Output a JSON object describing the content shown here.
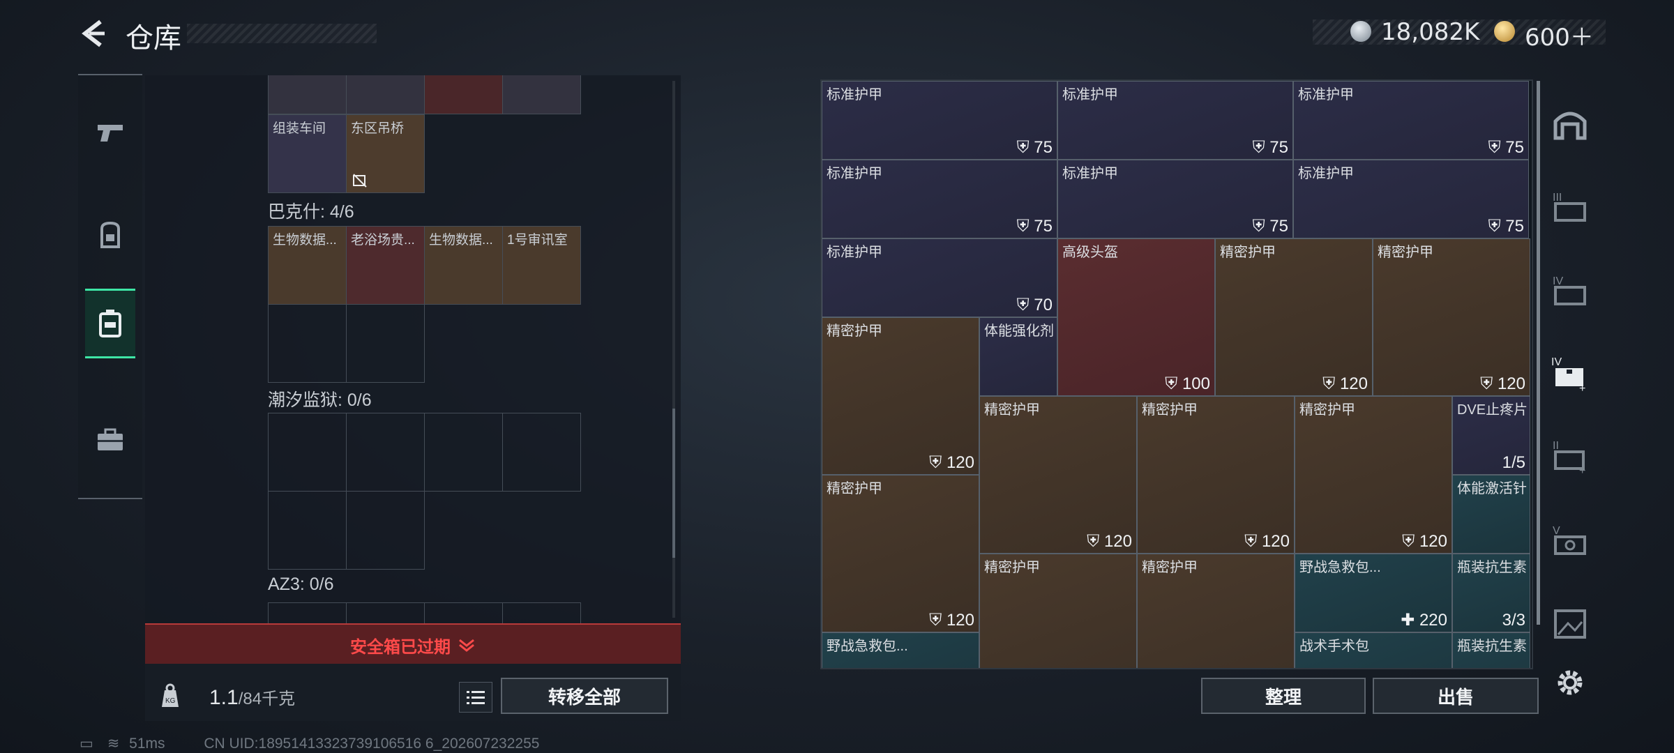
{
  "header": {
    "title": "仓库",
    "currency_1": "18,082K",
    "currency_2": "600＋"
  },
  "left_tabs": [
    "pistol-icon",
    "backpack-icon",
    "safebox-icon",
    "briefcase-icon"
  ],
  "key_groups": [
    {
      "label": "",
      "cells": [
        {
          "name": ""
        },
        {
          "name": ""
        },
        {
          "name": ""
        },
        {
          "name": ""
        }
      ]
    },
    {
      "label": "",
      "cells": [
        {
          "name": "组装车间"
        },
        {
          "name": "东区吊桥"
        }
      ]
    },
    {
      "label": "巴克什: 4/6",
      "cells": [
        {
          "name": "生物数据..."
        },
        {
          "name": "老浴场贵..."
        },
        {
          "name": "生物数据..."
        },
        {
          "name": "1号审讯室"
        }
      ]
    },
    {
      "label": "潮汐监狱: 0/6"
    },
    {
      "label": "AZ3: 0/6"
    }
  ],
  "safebox_status": "安全箱已过期",
  "weight": {
    "current": "1.1",
    "max": "/84千克"
  },
  "buttons": {
    "transfer_all": "转移全部",
    "sort": "整理",
    "sell": "出售"
  },
  "items": [
    {
      "name": "标准护甲",
      "value": "75"
    },
    {
      "name": "标准护甲",
      "value": "75"
    },
    {
      "name": "标准护甲",
      "value": "75"
    },
    {
      "name": "标准护甲",
      "value": "75"
    },
    {
      "name": "标准护甲",
      "value": "75"
    },
    {
      "name": "标准护甲",
      "value": "75"
    },
    {
      "name": "标准护甲",
      "value": "70"
    },
    {
      "name": "高级头盔",
      "value": "100"
    },
    {
      "name": "精密护甲",
      "value": "120"
    },
    {
      "name": "精密护甲",
      "value": "120"
    },
    {
      "name": "精密护甲",
      "value": "120"
    },
    {
      "name": "体能强化剂",
      "value": ""
    },
    {
      "name": "精密护甲",
      "value": "120"
    },
    {
      "name": "精密护甲",
      "value": "120"
    },
    {
      "name": "精密护甲",
      "value": "120"
    },
    {
      "name": "DVE止疼片",
      "value": "1/5"
    },
    {
      "name": "精密护甲",
      "value": "120"
    },
    {
      "name": "体能激活针",
      "value": ""
    },
    {
      "name": "精密护甲",
      "value": ""
    },
    {
      "name": "精密护甲",
      "value": ""
    },
    {
      "name": "野战急救包...",
      "value": "220"
    },
    {
      "name": "瓶装抗生素",
      "value": "3/3"
    },
    {
      "name": "野战急救包...",
      "value": ""
    },
    {
      "name": "战术手术包",
      "value": ""
    },
    {
      "name": "瓶装抗生素",
      "value": ""
    }
  ],
  "status_bar": {
    "ping": "51ms",
    "uid": "CN UID:18951413323739106516 6_202607232255"
  }
}
